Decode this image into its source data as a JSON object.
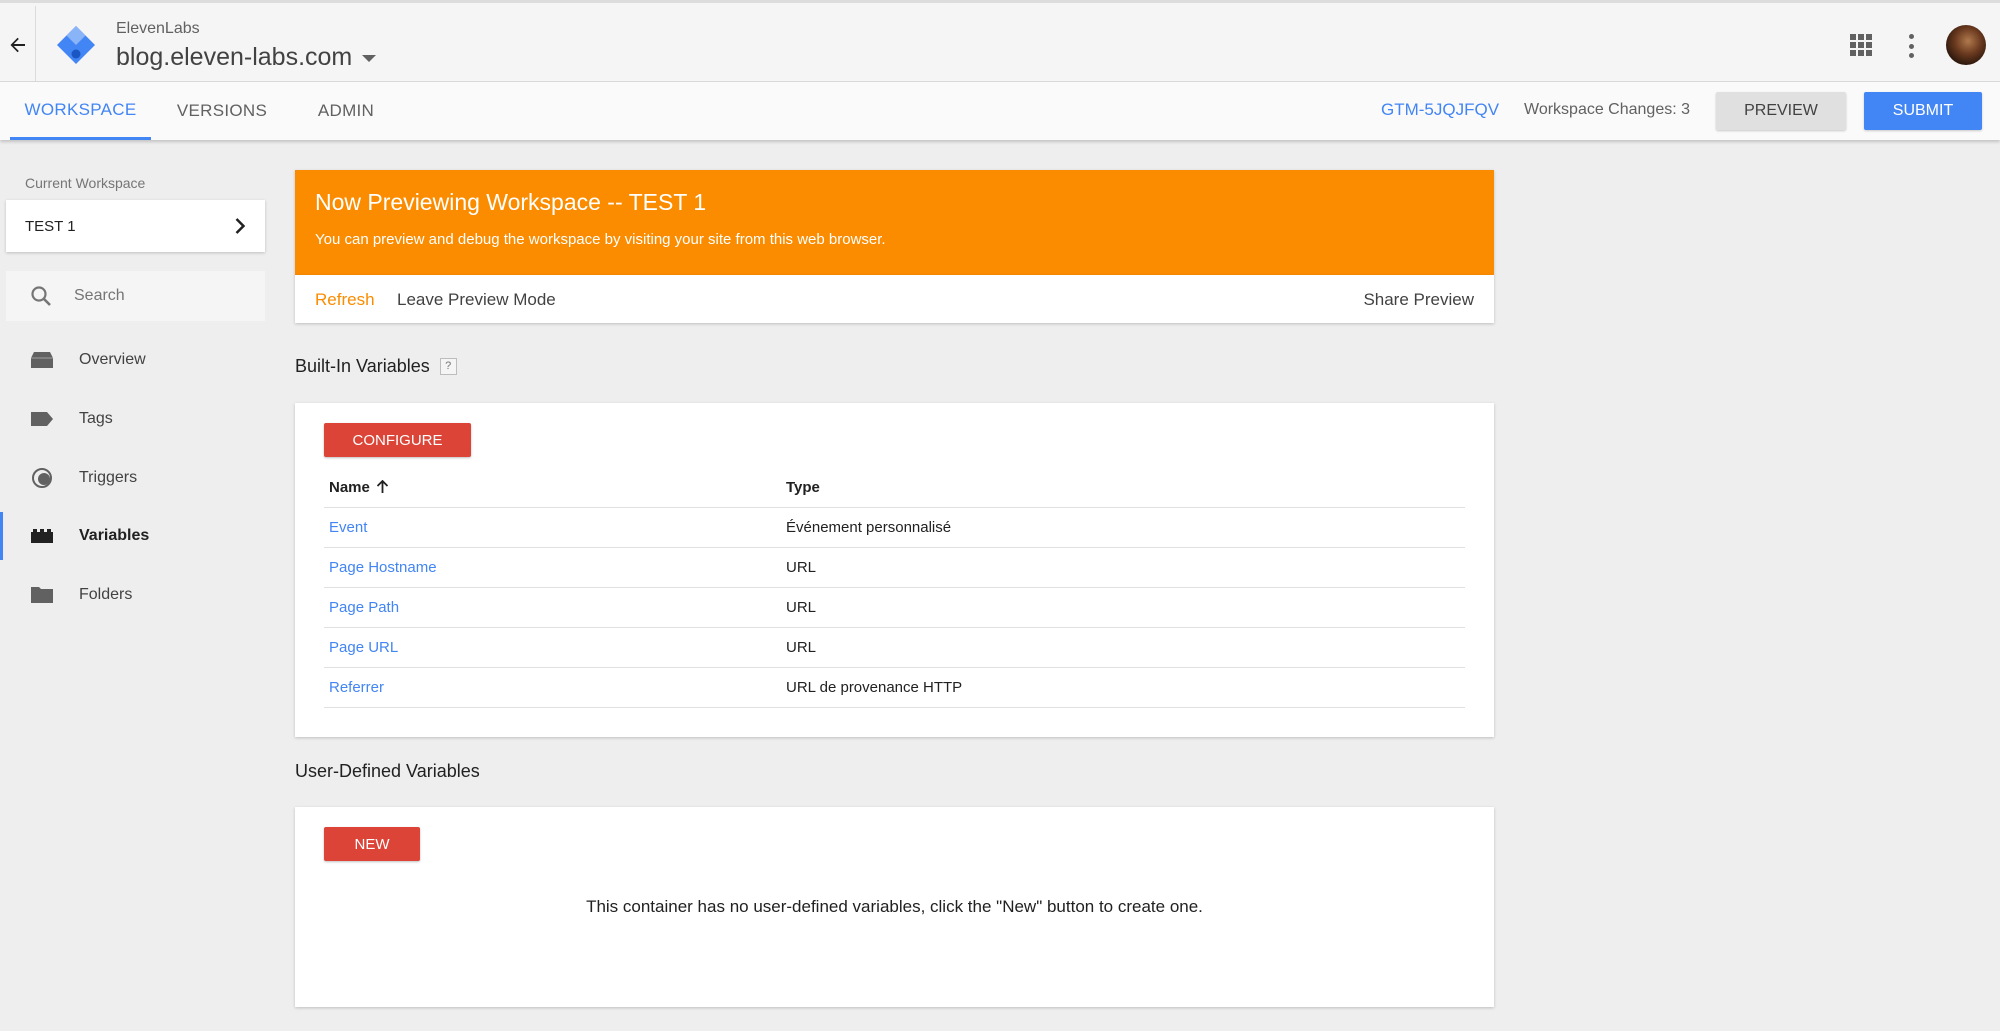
{
  "header": {
    "account_name": "ElevenLabs",
    "container_name": "blog.eleven-labs.com"
  },
  "nav": {
    "tabs": [
      {
        "label": "WORKSPACE",
        "active": true
      },
      {
        "label": "VERSIONS",
        "active": false
      },
      {
        "label": "ADMIN",
        "active": false
      }
    ],
    "container_id": "GTM-5JQJFQV",
    "workspace_changes": "Workspace Changes: 3",
    "preview_label": "PREVIEW",
    "submit_label": "SUBMIT"
  },
  "sidebar": {
    "current_workspace_label": "Current Workspace",
    "current_workspace": "TEST 1",
    "search_placeholder": "Search",
    "items": [
      {
        "label": "Overview",
        "icon": "overview-icon",
        "active": false
      },
      {
        "label": "Tags",
        "icon": "tag-icon",
        "active": false
      },
      {
        "label": "Triggers",
        "icon": "trigger-icon",
        "active": false
      },
      {
        "label": "Variables",
        "icon": "variables-icon",
        "active": true
      },
      {
        "label": "Folders",
        "icon": "folder-icon",
        "active": false
      }
    ]
  },
  "preview_banner": {
    "title": "Now Previewing Workspace -- TEST 1",
    "subtitle": "You can preview and debug the workspace by visiting your site from this web browser.",
    "refresh_label": "Refresh",
    "leave_label": "Leave Preview Mode",
    "share_label": "Share Preview"
  },
  "built_in": {
    "title": "Built-In Variables",
    "help": "?",
    "configure_label": "CONFIGURE",
    "columns": {
      "name": "Name",
      "type": "Type"
    },
    "rows": [
      {
        "name": "Event",
        "type": "Événement personnalisé"
      },
      {
        "name": "Page Hostname",
        "type": "URL"
      },
      {
        "name": "Page Path",
        "type": "URL"
      },
      {
        "name": "Page URL",
        "type": "URL"
      },
      {
        "name": "Referrer",
        "type": "URL de provenance HTTP"
      }
    ]
  },
  "user_defined": {
    "title": "User-Defined Variables",
    "new_label": "NEW",
    "empty_text": "This container has no user-defined variables, click the \"New\" button to create one."
  },
  "colors": {
    "accent": "#4285f4",
    "banner": "#fb8c00",
    "danger": "#db4437"
  }
}
